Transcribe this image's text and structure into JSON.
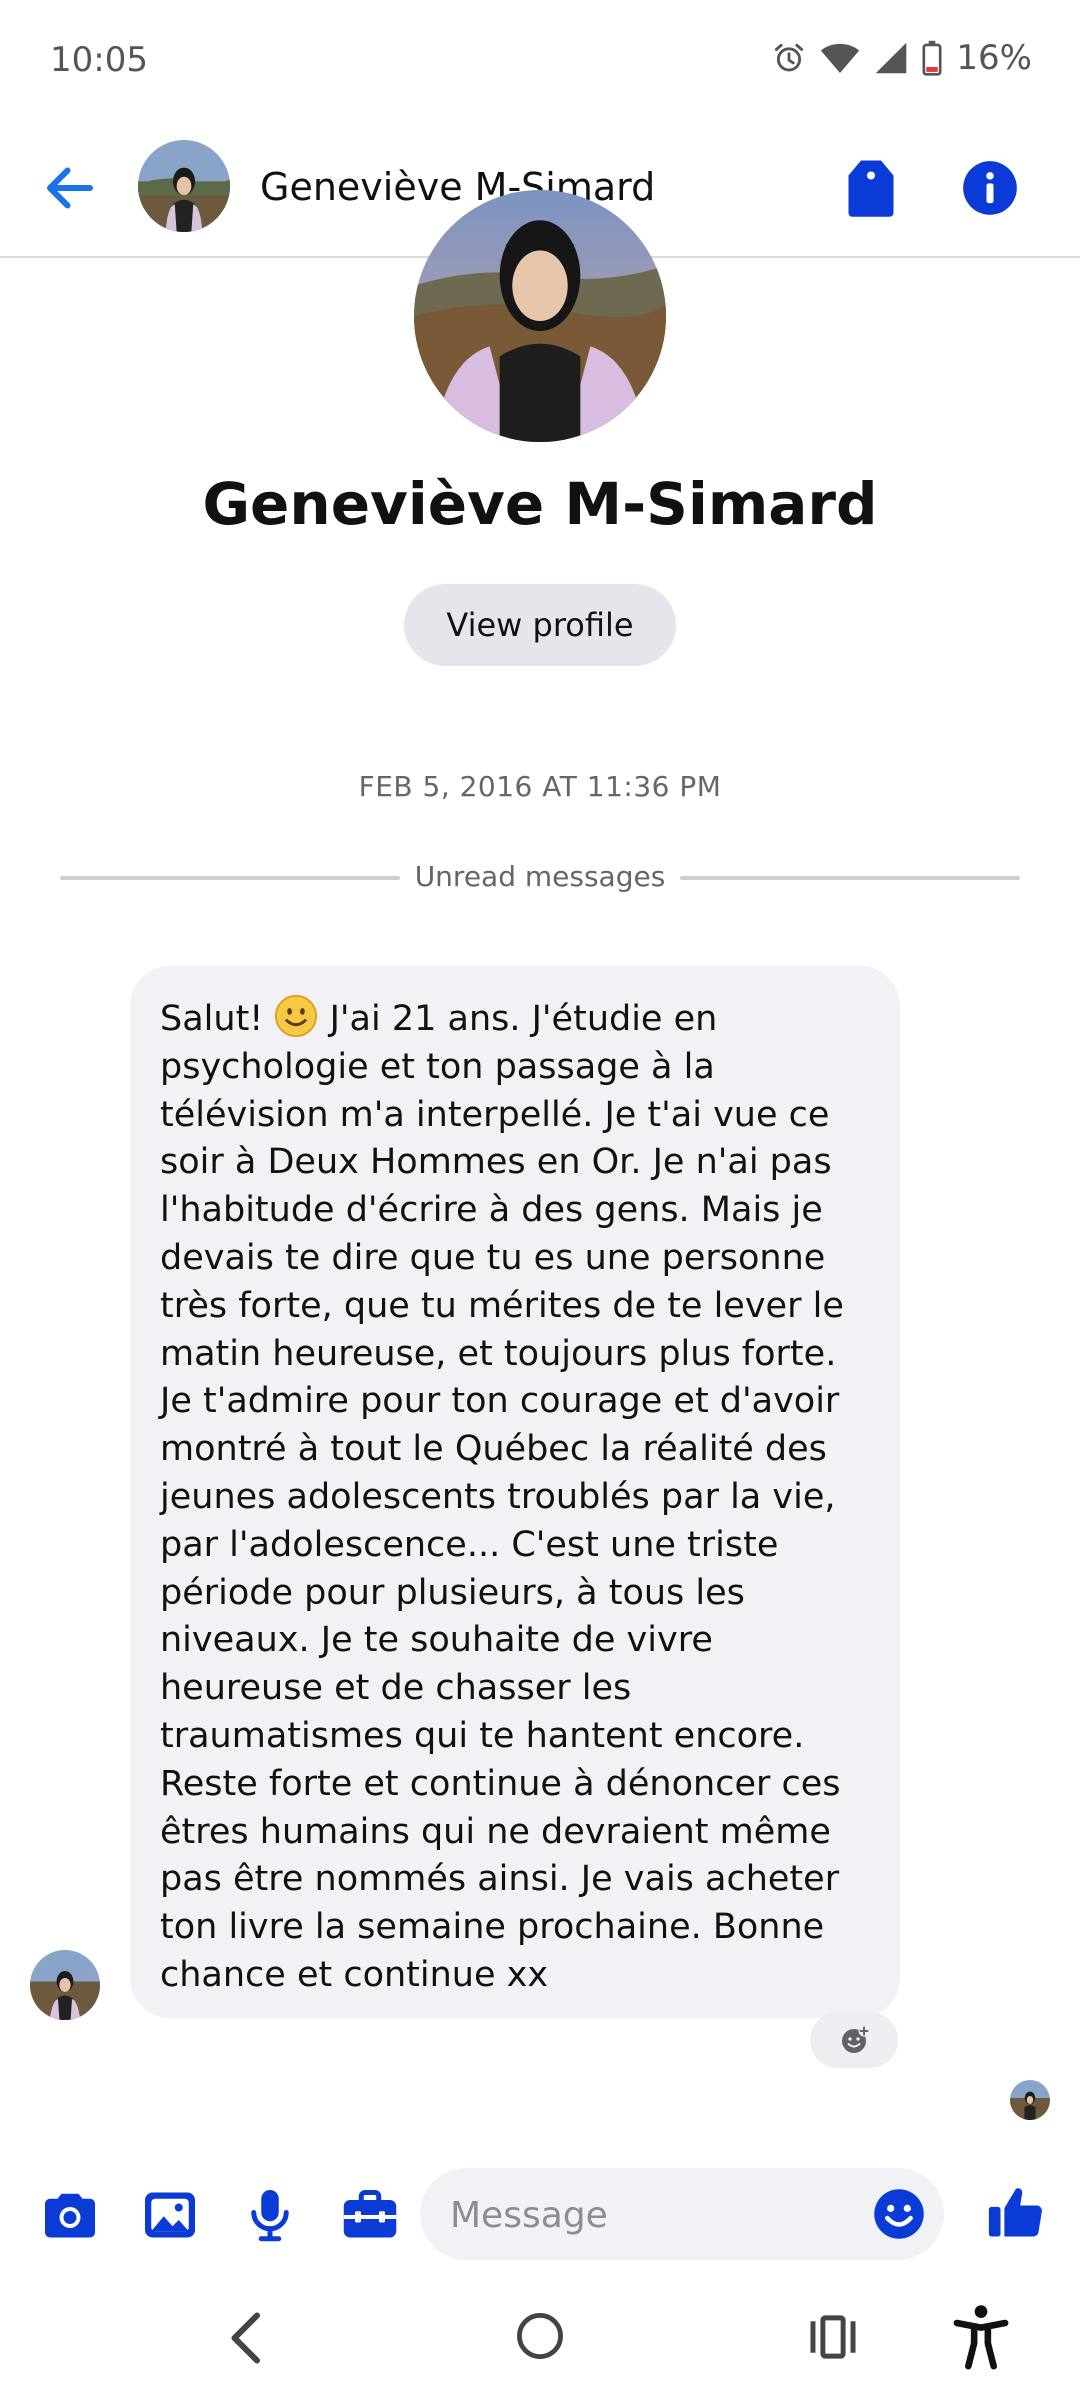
{
  "status_bar": {
    "time": "10:05",
    "battery": "16%"
  },
  "header": {
    "contact_name": "Geneviève M-Simard"
  },
  "profile": {
    "name": "Geneviève M-Simard",
    "view_profile_label": "View profile"
  },
  "thread": {
    "timestamp": "FEB 5, 2016 AT 11:36 PM",
    "unread_label": "Unread messages",
    "message": {
      "lead": "Salut! ",
      "body": "J'ai 21 ans. J'étudie en psychologie et ton passage à la télévision m'a interpellé. Je t'ai vue ce soir à Deux Hommes en Or. Je n'ai pas l'habitude d'écrire à des gens. Mais je devais te dire que tu es une personne très forte, que tu mérites de te lever le matin heureuse, et toujours plus forte. Je t'admire pour ton courage et d'avoir montré à tout le Québec la réalité des jeunes adolescents troublés par la vie, par l'adolescence... C'est une triste période pour plusieurs, à tous les niveaux. Je te souhaite de vivre heureuse et de chasser les traumatismes qui te hantent encore. Reste forte et continue à dénoncer ces êtres humains qui ne devraient même pas être nommés ainsi. Je vais acheter ton livre la semaine prochaine. Bonne chance et continue xx"
    }
  },
  "composer": {
    "placeholder": "Message"
  },
  "colors": {
    "accent": "#0a3bd6",
    "back_arrow": "#1a73e8",
    "bubble_bg": "#f0f2f5"
  },
  "icons": [
    "back-arrow-icon",
    "tag-icon",
    "info-icon",
    "camera-icon",
    "gallery-icon",
    "microphone-icon",
    "briefcase-icon",
    "emoji-icon",
    "thumbs-up-icon",
    "add-reaction-icon",
    "nav-back-icon",
    "nav-home-icon",
    "nav-recents-icon",
    "accessibility-icon",
    "alarm-icon",
    "wifi-icon",
    "signal-icon",
    "battery-icon"
  ]
}
